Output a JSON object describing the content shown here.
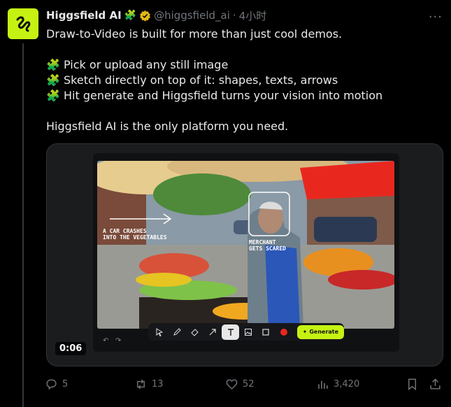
{
  "author": {
    "name": "Higgsfield AI",
    "name_emoji": "🧩",
    "handle": "@higgsfield_ai",
    "separator": "·",
    "time": "4小时"
  },
  "tweet": {
    "lines": [
      "Draw-to-Video is built for more than just cool demos.",
      "🧩 Pick or upload any still image",
      "🧩 Sketch directly on top of it: shapes, texts, arrows",
      "🧩 Hit generate and Higgsfield turns your vision into motion",
      "Higgsfield AI is the only platform you need."
    ]
  },
  "media": {
    "annotation_1": "A CAR CRASHES\nINTO THE VEGETABLES",
    "annotation_2": "MERCHANT\nGETS SCARED",
    "generate_label": "Generate",
    "duration": "0:06"
  },
  "actions": {
    "replies": "5",
    "reposts": "13",
    "likes": "52",
    "views": "3,420"
  },
  "colors": {
    "accent": "#c6f213",
    "verified": "#e2b719"
  }
}
